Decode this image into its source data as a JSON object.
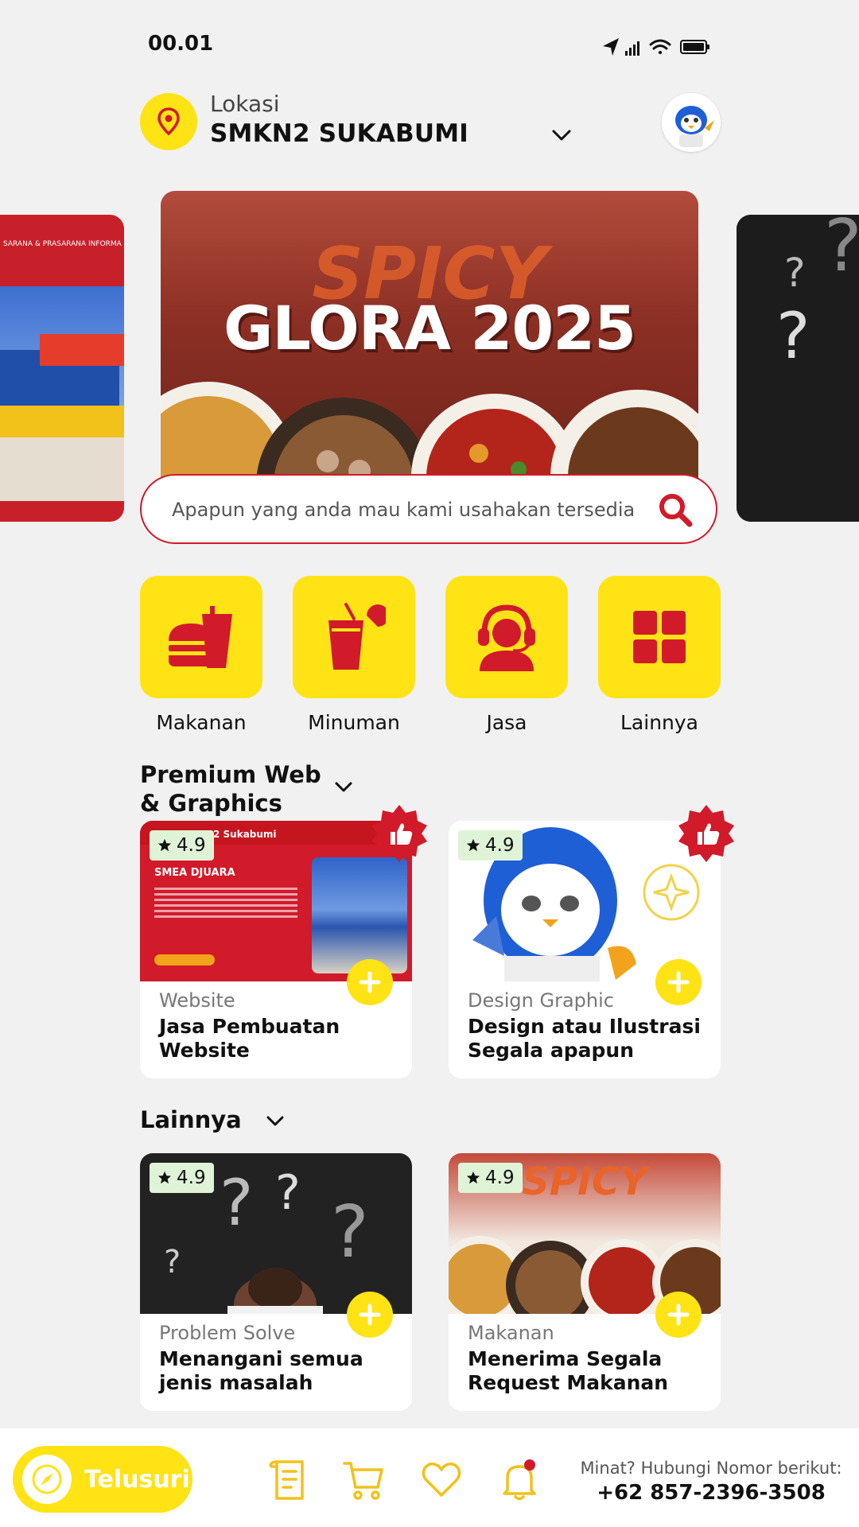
{
  "status_bar": {
    "time": "00.01"
  },
  "location": {
    "label": "Lokasi",
    "value": "SMKN2 SUKABUMI"
  },
  "banner": {
    "title": "GLORA 2025",
    "decor_text": "SPICY",
    "left_preview_text": "SARANA & PRASARANA   INFORMA"
  },
  "search": {
    "placeholder": "Apapun yang anda mau kami usahakan tersedia"
  },
  "categories": [
    {
      "label": "Makanan",
      "icon": "fastfood-icon"
    },
    {
      "label": "Minuman",
      "icon": "drink-icon"
    },
    {
      "label": "Jasa",
      "icon": "support-agent-icon"
    },
    {
      "label": "Lainnya",
      "icon": "grid-icon"
    }
  ],
  "sections": [
    {
      "title": "Premium Web & Graphics",
      "cards": [
        {
          "rating": "4.9",
          "category": "Website",
          "title": "Jasa Pembuatan Website",
          "image_text": "SMEA DJUARA",
          "image_header": "2 Sukabumi"
        },
        {
          "rating": "4.9",
          "category": "Design Graphic",
          "title": "Design atau Ilustrasi Segala apapun"
        }
      ]
    },
    {
      "title": "Lainnya",
      "cards": [
        {
          "rating": "4.9",
          "category": "Problem Solve",
          "title": "Menangani semua jenis masalah"
        },
        {
          "rating": "4.9",
          "category": "Makanan",
          "title": "Menerima Segala Request Makanan",
          "image_text": "SPICY"
        }
      ]
    }
  ],
  "bottom_nav": {
    "explore_label": "Telusuri",
    "icons": [
      "receipt-icon",
      "cart-icon",
      "heart-icon",
      "bell-icon"
    ],
    "contact_label": "Minat? Hubungi Nomor berikut:",
    "contact_number": "+62 857-2396-3508"
  },
  "colors": {
    "accent": "#FFE315",
    "brand_red": "#d11a2a",
    "background": "#f1f1f1"
  }
}
